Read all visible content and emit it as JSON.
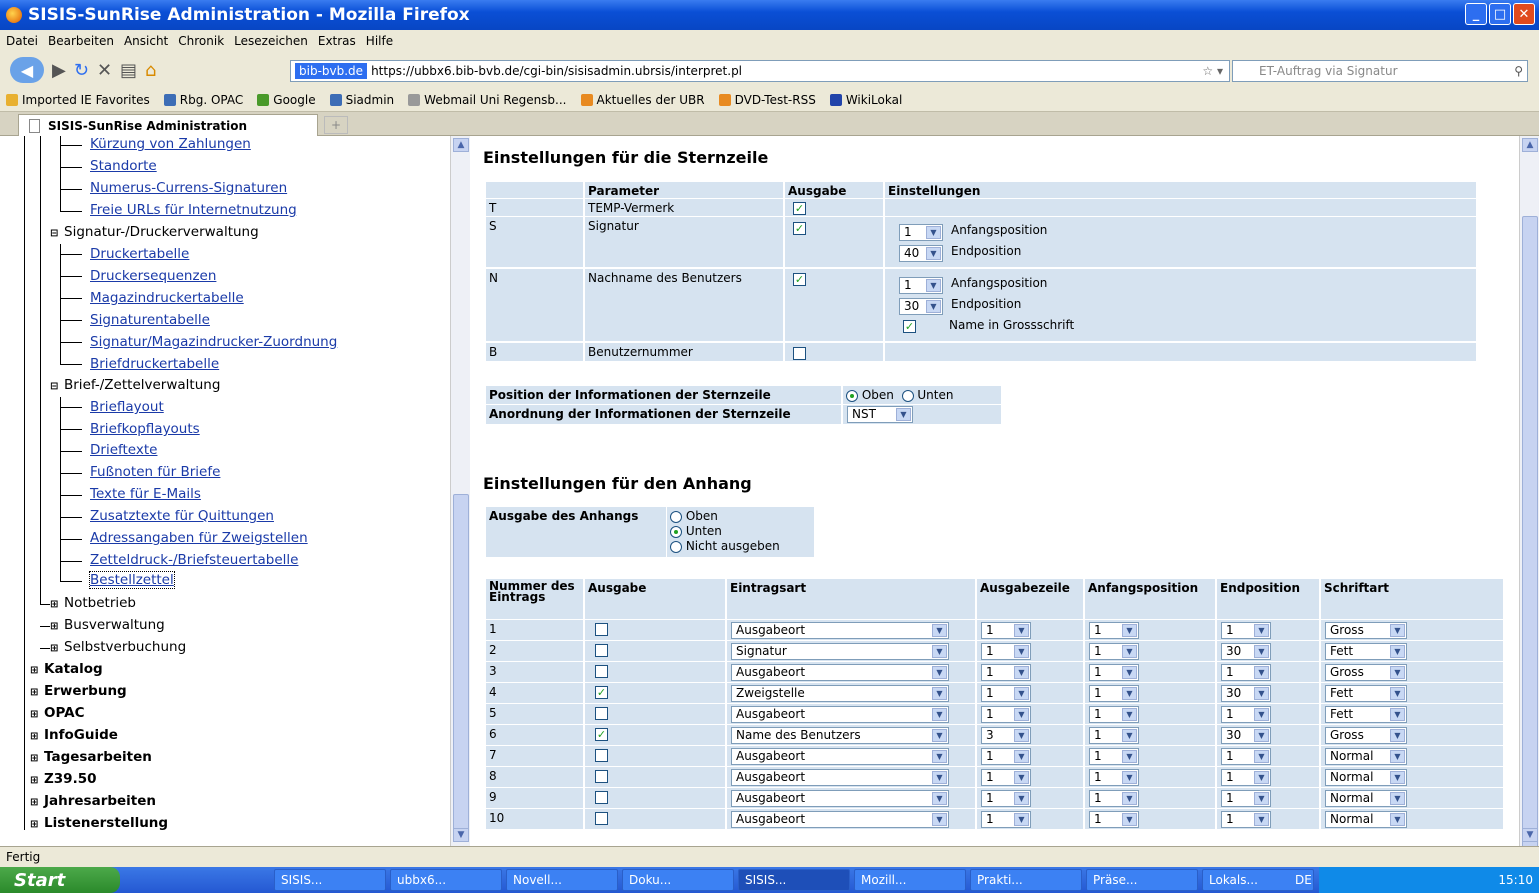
{
  "window": {
    "title": "SISIS-SunRise Administration - Mozilla Firefox"
  },
  "menu": [
    "Datei",
    "Bearbeiten",
    "Ansicht",
    "Chronik",
    "Lesezeichen",
    "Extras",
    "Hilfe"
  ],
  "nav": {
    "site_label": "bib-bvb.de",
    "url": "https://ubbx6.bib-bvb.de/cgi-bin/sisisadmin.ubrsis/interpret.pl",
    "search_placeholder": "ET-Auftrag via Signatur"
  },
  "bookmarks": [
    "Imported IE Favorites",
    "Rbg. OPAC",
    "Google",
    "Siadmin",
    "Webmail Uni Regensb...",
    "Aktuelles der UBR",
    "DVD-Test-RSS",
    "WikiLokal"
  ],
  "tab": {
    "label": "SISIS-SunRise Administration",
    "plus": "+"
  },
  "tree": {
    "leaf_top": [
      "Kürzung von Zahlungen",
      "Standorte",
      "Numerus-Currens-Signaturen",
      "Freie URLs für Internetnutzung"
    ],
    "group1": "Signatur-/Druckerverwaltung",
    "group1_items": [
      "Druckertabelle",
      "Druckersequenzen",
      "Magazindruckertabelle",
      "Signaturentabelle",
      "Signatur/Magazindrucker-Zuordnung",
      "Briefdruckertabelle"
    ],
    "group2": "Brief-/Zettelverwaltung",
    "group2_items": [
      "Brieflayout",
      "Briefkopflayouts",
      "Drieftexte",
      "Fußnoten für Briefe",
      "Texte für E-Mails",
      "Zusatztexte für Quittungen",
      "Adressangaben für Zweigstellen",
      "Zetteldruck-/Briefsteuertabelle",
      "Bestellzettel"
    ],
    "groups3": [
      "Notbetrieb",
      "Busverwaltung",
      "Selbstverbuchung"
    ],
    "top": [
      "Katalog",
      "Erwerbung",
      "OPAC",
      "InfoGuide",
      "Tagesarbeiten",
      "Z39.50",
      "Jahresarbeiten",
      "Listenerstellung"
    ]
  },
  "sternzeile": {
    "title": "Einstellungen für die Sternzeile",
    "headers": [
      "Parameter",
      "Ausgabe",
      "Einstellungen"
    ],
    "rows": [
      {
        "code": "T",
        "param": "TEMP-Vermerk",
        "checked": true
      },
      {
        "code": "S",
        "param": "Signatur",
        "checked": true,
        "start": "1",
        "end": "40",
        "start_label": "Anfangsposition",
        "end_label": "Endposition"
      },
      {
        "code": "N",
        "param": "Nachname des Benutzers",
        "checked": true,
        "start": "1",
        "end": "30",
        "start_label": "Anfangsposition",
        "end_label": "Endposition",
        "extra_label": "Name in Grossschrift",
        "extra_checked": true
      },
      {
        "code": "B",
        "param": "Benutzernummer",
        "checked": false
      }
    ],
    "position_label": "Position der Informationen der Sternzeile",
    "position_options": [
      "Oben",
      "Unten"
    ],
    "position_selected": "Oben",
    "order_label": "Anordnung der Informationen der Sternzeile",
    "order_value": "NST"
  },
  "anhang": {
    "title": "Einstellungen für den Anhang",
    "ausgabe_label": "Ausgabe des Anhangs",
    "options": [
      "Oben",
      "Unten",
      "Nicht ausgeben"
    ],
    "selected": "Unten",
    "headers": [
      "Nummer des Eintrags",
      "Ausgabe",
      "Eintragsart",
      "Ausgabezeile",
      "Anfangsposition",
      "Endposition",
      "Schriftart"
    ],
    "rows": [
      {
        "n": "1",
        "checked": false,
        "art": "Ausgabeort",
        "zeile": "1",
        "start": "1",
        "end": "1",
        "font": "Gross"
      },
      {
        "n": "2",
        "checked": false,
        "art": "Signatur",
        "zeile": "1",
        "start": "1",
        "end": "30",
        "font": "Fett"
      },
      {
        "n": "3",
        "checked": false,
        "art": "Ausgabeort",
        "zeile": "1",
        "start": "1",
        "end": "1",
        "font": "Gross"
      },
      {
        "n": "4",
        "checked": true,
        "art": "Zweigstelle",
        "zeile": "1",
        "start": "1",
        "end": "30",
        "font": "Fett"
      },
      {
        "n": "5",
        "checked": false,
        "art": "Ausgabeort",
        "zeile": "1",
        "start": "1",
        "end": "1",
        "font": "Fett"
      },
      {
        "n": "6",
        "checked": true,
        "art": "Name des Benutzers",
        "zeile": "3",
        "start": "1",
        "end": "30",
        "font": "Gross"
      },
      {
        "n": "7",
        "checked": false,
        "art": "Ausgabeort",
        "zeile": "1",
        "start": "1",
        "end": "1",
        "font": "Normal"
      },
      {
        "n": "8",
        "checked": false,
        "art": "Ausgabeort",
        "zeile": "1",
        "start": "1",
        "end": "1",
        "font": "Normal"
      },
      {
        "n": "9",
        "checked": false,
        "art": "Ausgabeort",
        "zeile": "1",
        "start": "1",
        "end": "1",
        "font": "Normal"
      },
      {
        "n": "10",
        "checked": false,
        "art": "Ausgabeort",
        "zeile": "1",
        "start": "1",
        "end": "1",
        "font": "Normal"
      }
    ]
  },
  "status": "Fertig",
  "taskbar": {
    "start": "Start",
    "items": [
      "SISIS...",
      "ubbx6...",
      "Novell...",
      "Doku...",
      "SISIS...",
      "Mozill...",
      "Prakti...",
      "Präse...",
      "Lokals..."
    ],
    "lang": "DE",
    "time": "15:10"
  },
  "colors": {
    "cell_bg": "#d6e3f0",
    "link": "#1a3aa8",
    "titlebar": "#0a4fd6"
  }
}
